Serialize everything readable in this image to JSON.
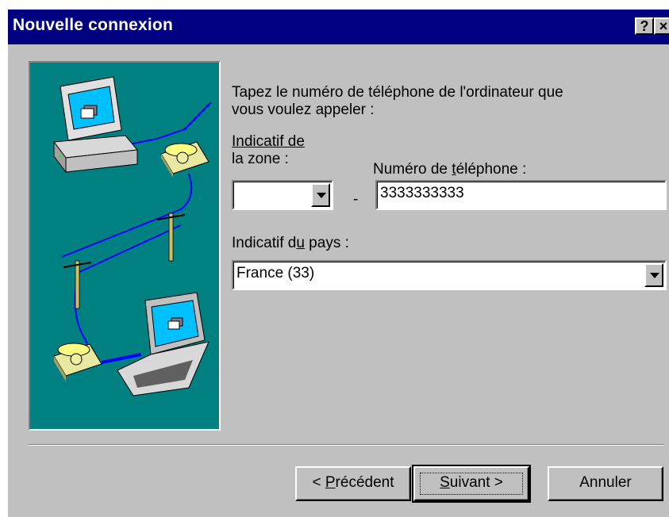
{
  "window": {
    "title": "Nouvelle connexion",
    "help_label": "?",
    "close_label": "×"
  },
  "instruction": {
    "line1": "Tapez le numéro de téléphone de l'ordinateur que",
    "line2": "vous voulez appeler :"
  },
  "area_code": {
    "label_line1": "Indicatif de",
    "label_line2": "la zone  :",
    "value": ""
  },
  "dash": "-",
  "phone": {
    "label_pre": "Numéro de ",
    "label_ul": "t",
    "label_post": "éléphone :",
    "value": "3333333333"
  },
  "country": {
    "label_pre": "Indicatif d",
    "label_ul": "u",
    "label_post": " pays :",
    "value": "France (33)"
  },
  "buttons": {
    "back_pre": "< ",
    "back_ul": "P",
    "back_post": "récédent",
    "next_ul": "S",
    "next_post": "uivant >",
    "cancel": "Annuler"
  },
  "colors": {
    "titlebar": "#000080",
    "art_background": "#008080",
    "dialog": "#c0c0c0"
  },
  "icons": [
    "help-icon",
    "close-icon",
    "computer-icon",
    "telephone-icon",
    "telegraph-pole-icon",
    "laptop-icon",
    "dropdown-arrow-icon"
  ]
}
